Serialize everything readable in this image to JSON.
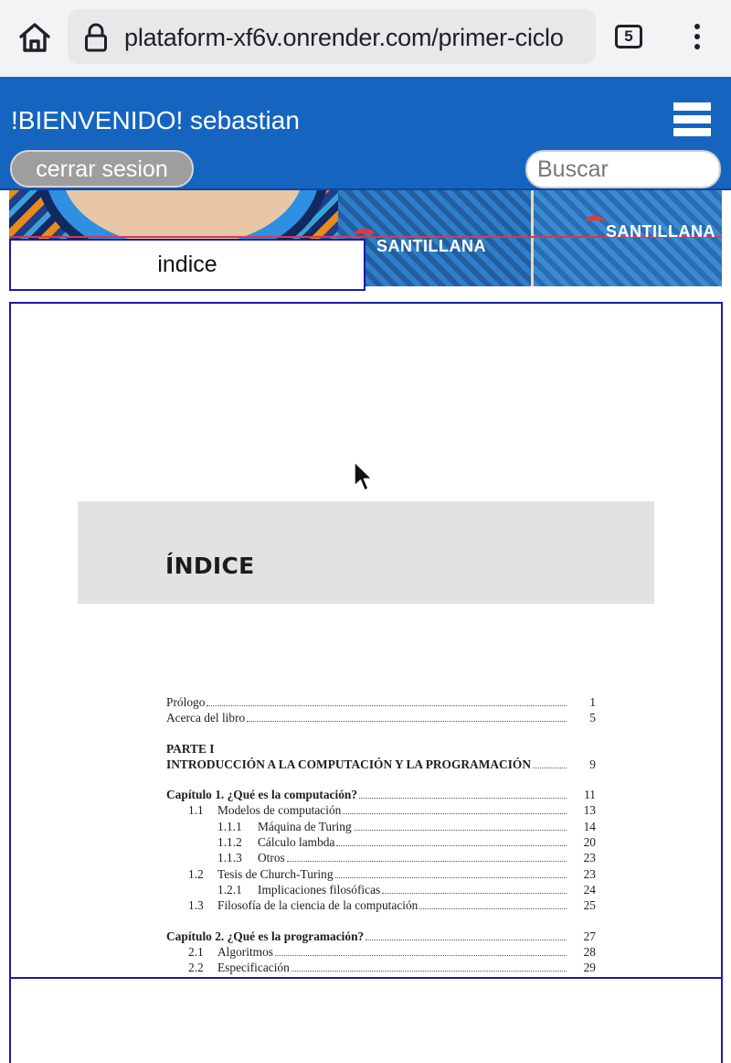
{
  "browser": {
    "url": "plataform-xf6v.onrender.com/primer-ciclo",
    "tab_count": "5",
    "icons": [
      "home-icon",
      "lock-icon",
      "tabs-icon",
      "more-vert-icon"
    ]
  },
  "header": {
    "welcome": "!BIENVENIDO! sebastian",
    "logout_label": "cerrar sesion",
    "search_placeholder": "Buscar",
    "colors": {
      "header_bg": "#1565c0",
      "logout_bg": "#9e9e9e"
    }
  },
  "banner": {
    "brand_left": "SANTILLANA",
    "brand_right": "SANTILLANA"
  },
  "tabs": {
    "index_label": "indice"
  },
  "document": {
    "heading": "ÍNDICE",
    "entries": [
      {
        "label": "Prólogo",
        "page": "1"
      },
      {
        "label": "Acerca del libro",
        "page": "5"
      },
      {
        "part": "PARTE I"
      },
      {
        "label": "INTRODUCCIÓN A LA COMPUTACIÓN Y LA PROGRAMACIÓN",
        "page": "9"
      },
      {
        "label": "Capítulo 1.  ¿Qué es la computación?",
        "page": "11"
      },
      {
        "num": "1.1",
        "label": "Modelos de computación",
        "page": "13"
      },
      {
        "num": "1.1.1",
        "label": "Máquina de Turing",
        "page": "14"
      },
      {
        "num": "1.1.2",
        "label": "Cálculo lambda",
        "page": "20"
      },
      {
        "num": "1.1.3",
        "label": "Otros",
        "page": "23"
      },
      {
        "num": "1.2",
        "label": "Tesis de Church-Turing",
        "page": "23"
      },
      {
        "num": "1.2.1",
        "label": "Implicaciones filosóficas",
        "page": "24"
      },
      {
        "num": "1.3",
        "label": "Filosofía de la ciencia de la computación",
        "page": "25"
      },
      {
        "label": "Capítulo 2.  ¿Qué es la programación?",
        "page": "27"
      },
      {
        "num": "2.1",
        "label": "Algoritmos",
        "page": "28"
      },
      {
        "num": "2.2",
        "label": "Especificación",
        "page": "29"
      }
    ]
  }
}
